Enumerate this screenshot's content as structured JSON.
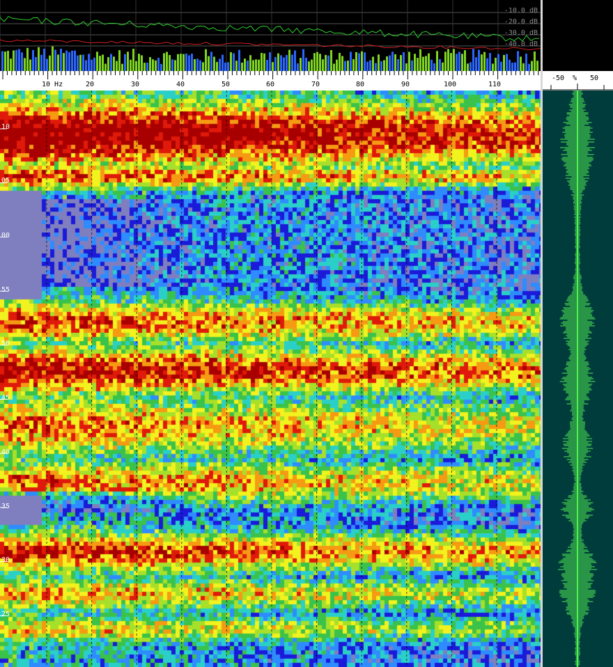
{
  "spectrum": {
    "db_levels": [
      "-10.0 dB",
      "-20.0 dB",
      "-30.0 dB",
      "-40.0 dB"
    ],
    "colors": {
      "peak_line": "#2fd02f",
      "avg_line": "#d42020",
      "bars_low": "#2b66ff",
      "bars_high": "#7fd620"
    }
  },
  "ruler": {
    "first_label": "10 Hz",
    "labels": [
      "20",
      "30",
      "40",
      "50",
      "60",
      "70",
      "80",
      "90",
      "100",
      "110"
    ]
  },
  "spectrogram": {
    "time_labels": [
      "10",
      "05",
      "00",
      "55",
      "50",
      "45",
      "40",
      "35",
      "30",
      "25"
    ],
    "palette": [
      "#7f7fc0",
      "#1a1ad8",
      "#2e8cff",
      "#2ad0c8",
      "#3ac24a",
      "#a6e02a",
      "#f2f21e",
      "#f59a12",
      "#e01a0a",
      "#a80000"
    ]
  },
  "waveform": {
    "scale_labels": [
      "-50",
      "%",
      "50"
    ],
    "colors": {
      "background": "#003c3c",
      "wave": "#50f050"
    }
  }
}
